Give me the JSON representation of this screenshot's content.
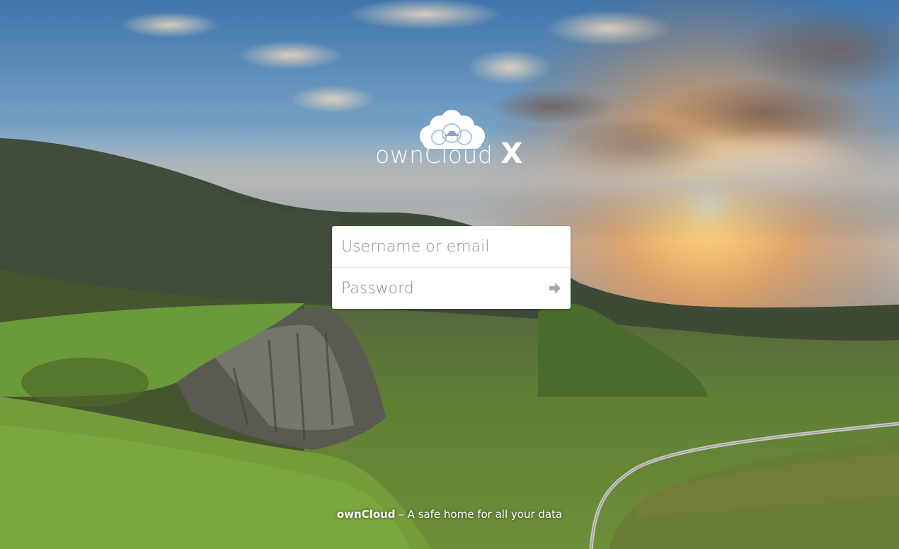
{
  "login": {
    "username_placeholder": "Username or email",
    "password_placeholder": "Password",
    "submit_icon": "arrow-right-icon"
  },
  "logo": {
    "text": "ownCloud",
    "suffix": "X",
    "icon": "cloud-icon"
  },
  "footer": {
    "brand": "ownCloud",
    "separator": " – ",
    "slogan": "A safe home for all your data"
  },
  "background": {
    "description_icon": "landscape-background"
  },
  "colors": {
    "sky_top": "#4d7fb4",
    "sun": "#ffd27a",
    "grass": "#5f8a3a"
  }
}
